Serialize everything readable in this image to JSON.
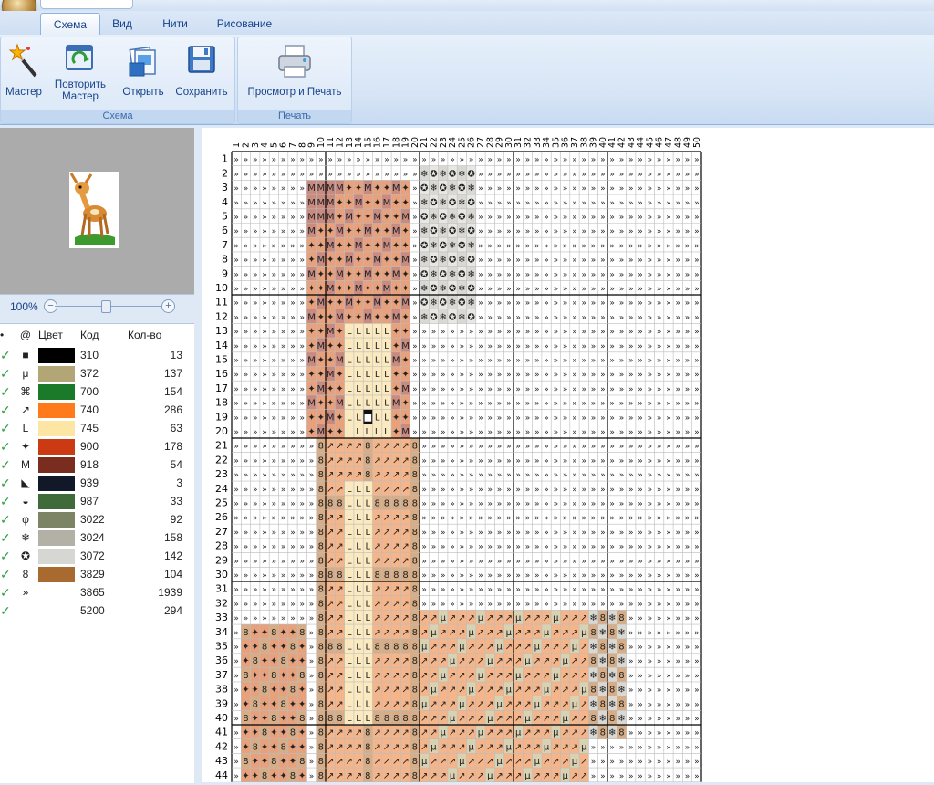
{
  "ribbon": {
    "tabs": [
      "Схема",
      "Вид",
      "Нити",
      "Рисование"
    ],
    "groups": {
      "scheme": "Схема",
      "print": "Печать"
    },
    "buttons": {
      "master": "Мастер",
      "repeat_line1": "Повторить",
      "repeat_line2": "Мастер",
      "open": "Открыть",
      "save": "Сохранить",
      "print": "Просмотр и Печать"
    }
  },
  "zoom": {
    "label": "100%"
  },
  "palette": {
    "headers": {
      "symbol": "@",
      "color": "Цвет",
      "code": "Код",
      "count": "Кол-во"
    },
    "rows": [
      {
        "symbol": "■",
        "color": "#000000",
        "code": "310",
        "count": "13"
      },
      {
        "symbol": "μ",
        "color": "#b3a676",
        "code": "372",
        "count": "137"
      },
      {
        "symbol": "⌘",
        "color": "#1a7a2a",
        "code": "700",
        "count": "154"
      },
      {
        "symbol": "↗",
        "color": "#ff7a1a",
        "code": "740",
        "count": "286"
      },
      {
        "symbol": "L",
        "color": "#fde6a3",
        "code": "745",
        "count": "63"
      },
      {
        "symbol": "✦",
        "color": "#cc3a14",
        "code": "900",
        "count": "178"
      },
      {
        "symbol": "M",
        "color": "#7a2c1e",
        "code": "918",
        "count": "54"
      },
      {
        "symbol": "◣",
        "color": "#111827",
        "code": "939",
        "count": "3"
      },
      {
        "symbol": "◒",
        "color": "#3f6b3a",
        "code": "987",
        "count": "33"
      },
      {
        "symbol": "φ",
        "color": "#7d8466",
        "code": "3022",
        "count": "92"
      },
      {
        "symbol": "❄",
        "color": "#b3b0a6",
        "code": "3024",
        "count": "158"
      },
      {
        "symbol": "✪",
        "color": "#d6d7d2",
        "code": "3072",
        "count": "142"
      },
      {
        "symbol": "8",
        "color": "#a86a2e",
        "code": "3829",
        "count": "104"
      },
      {
        "symbol": "»",
        "color": "#ffffff",
        "code": "3865",
        "count": "1939"
      },
      {
        "symbol": "",
        "color": "#ffffff",
        "code": "5200",
        "count": "294"
      }
    ]
  },
  "grid": {
    "columns": 50,
    "rows_visible": 44
  }
}
